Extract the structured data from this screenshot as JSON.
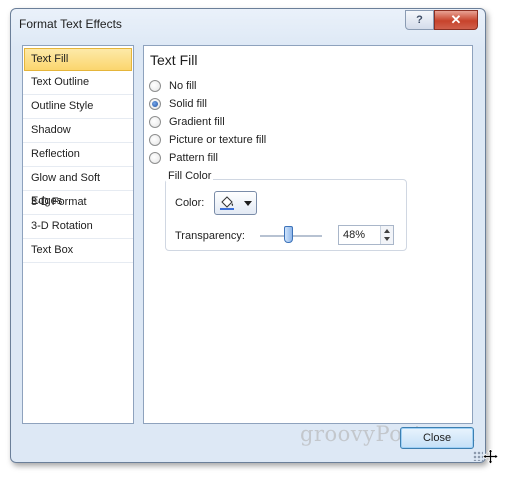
{
  "window": {
    "title": "Format Text Effects",
    "help_label": "?",
    "close_label": "✕"
  },
  "sidebar": {
    "items": [
      {
        "label": "Text Fill",
        "selected": true
      },
      {
        "label": "Text Outline"
      },
      {
        "label": "Outline Style"
      },
      {
        "label": "Shadow"
      },
      {
        "label": "Reflection"
      },
      {
        "label": "Glow and Soft Edges"
      },
      {
        "label": "3-D Format"
      },
      {
        "label": "3-D Rotation"
      },
      {
        "label": "Text Box"
      }
    ]
  },
  "panel": {
    "heading": "Text Fill",
    "options": [
      {
        "label": "No fill",
        "checked": false
      },
      {
        "label": "Solid fill",
        "checked": true
      },
      {
        "label": "Gradient fill",
        "checked": false
      },
      {
        "label": "Picture or texture fill",
        "checked": false
      },
      {
        "label": "Pattern fill",
        "checked": false
      }
    ],
    "fill_color": {
      "group_label": "Fill Color",
      "color_label": "Color:",
      "color_icon": "paint-bucket-icon",
      "swatch": "#3c6fd8",
      "transparency_label": "Transparency:",
      "transparency_value": "48%",
      "transparency_fraction": 0.48
    }
  },
  "footer": {
    "close_label": "Close",
    "watermark": "groovyPost.com"
  },
  "colors": {
    "accent": "#3c7fb1",
    "selected_item": "#fbd66e"
  }
}
